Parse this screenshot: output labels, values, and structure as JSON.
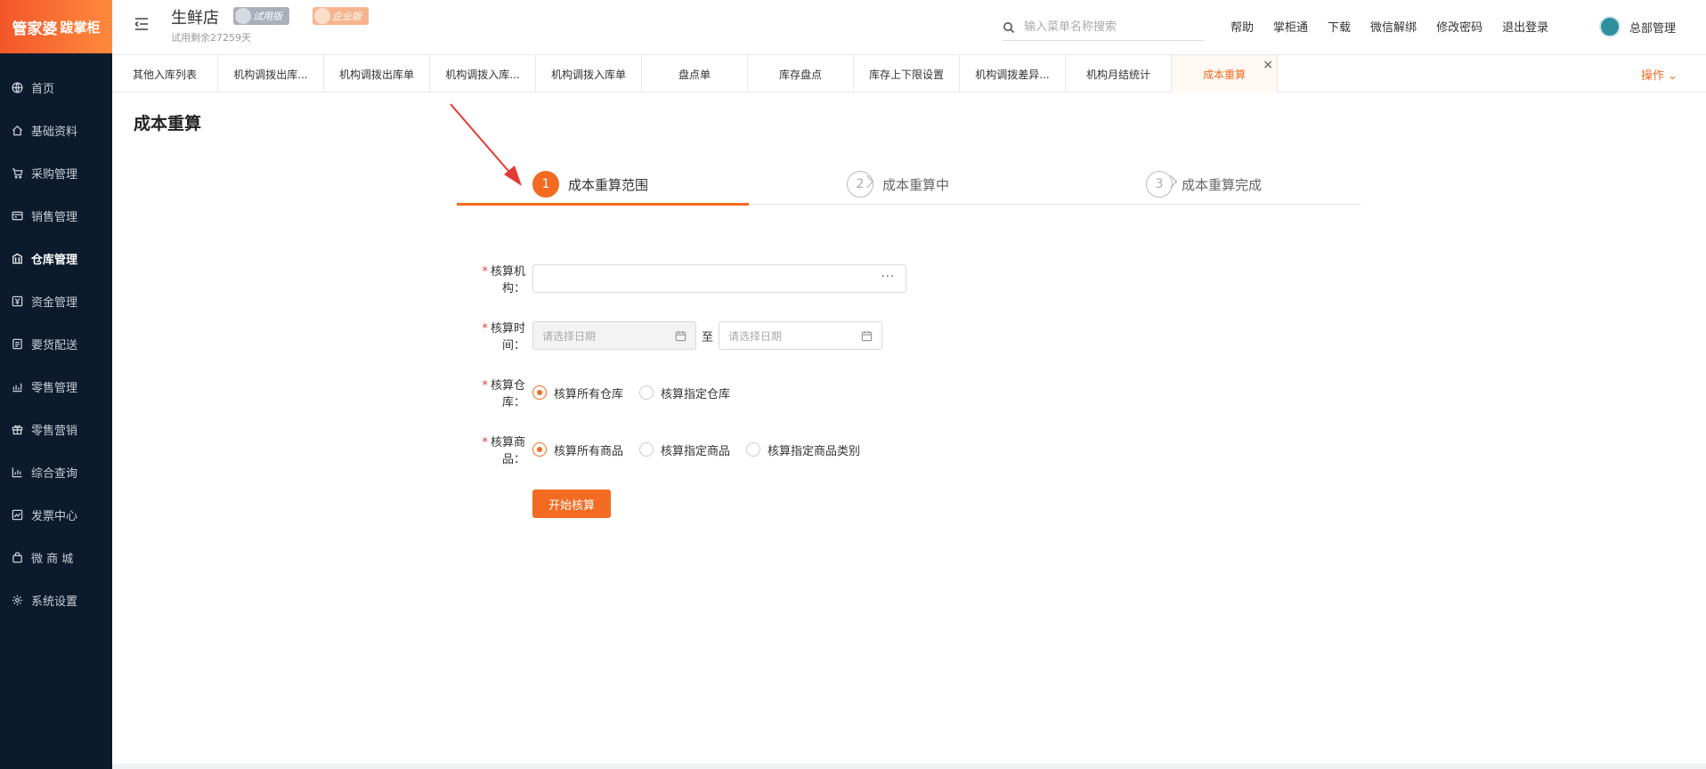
{
  "app": {
    "logo_main": "管家婆",
    "logo_sub": "跋掌柜"
  },
  "sidebar": {
    "items": [
      {
        "label": "首页",
        "icon": "globe-icon"
      },
      {
        "label": "基础资料",
        "icon": "home-icon"
      },
      {
        "label": "采购管理",
        "icon": "cart-icon"
      },
      {
        "label": "销售管理",
        "icon": "card-icon"
      },
      {
        "label": "仓库管理",
        "icon": "bank-icon",
        "active": true
      },
      {
        "label": "资金管理",
        "icon": "money-icon"
      },
      {
        "label": "要货配送",
        "icon": "list-icon"
      },
      {
        "label": "零售管理",
        "icon": "chart-icon"
      },
      {
        "label": "零售营销",
        "icon": "gift-icon"
      },
      {
        "label": "综合查询",
        "icon": "bar-chart-icon"
      },
      {
        "label": "发票中心",
        "icon": "trend-icon"
      },
      {
        "label": "微 商 城",
        "icon": "bag-icon"
      },
      {
        "label": "系统设置",
        "icon": "gear-icon"
      }
    ]
  },
  "header": {
    "store_name": "生鲜店",
    "badge_trial": "试用版",
    "badge_enterprise": "企业版",
    "trial_remaining": "试用剩余27259天",
    "search_placeholder": "输入菜单名称搜索",
    "links": [
      "帮助",
      "掌柜通",
      "下载",
      "微信解绑",
      "修改密码",
      "退出登录"
    ],
    "user_name": "总部管理"
  },
  "tabs": {
    "items": [
      "其他入库列表",
      "机构调拨出库...",
      "机构调拨出库单",
      "机构调拨入库...",
      "机构调拨入库单",
      "盘点单",
      "库存盘点",
      "库存上下限设置",
      "机构调拨差异...",
      "机构月结统计",
      "成本重算"
    ],
    "active_index": 10,
    "ops_label": "操作 ⌄"
  },
  "page": {
    "title": "成本重算",
    "steps": [
      {
        "num": "1",
        "label": "成本重算范围",
        "active": true
      },
      {
        "num": "2",
        "label": "成本重算中",
        "active": false
      },
      {
        "num": "3",
        "label": "成本重算完成",
        "active": false
      }
    ],
    "form": {
      "org_label": "核算机构",
      "org_value": "",
      "org_picker": "···",
      "time_label": "核算时间",
      "date_start_placeholder": "请选择日期",
      "date_end_placeholder": "请选择日期",
      "date_sep": "至",
      "warehouse_label": "核算仓库",
      "warehouse_options": [
        "核算所有仓库",
        "核算指定仓库"
      ],
      "warehouse_selected": 0,
      "goods_label": "核算商品",
      "goods_options": [
        "核算所有商品",
        "核算指定商品",
        "核算指定商品类别"
      ],
      "goods_selected": 0,
      "submit_label": "开始核算"
    }
  },
  "colors": {
    "accent": "#f26b21",
    "sidebar_bg": "#0b1a2c",
    "annotation_arrow": "#e53935"
  }
}
